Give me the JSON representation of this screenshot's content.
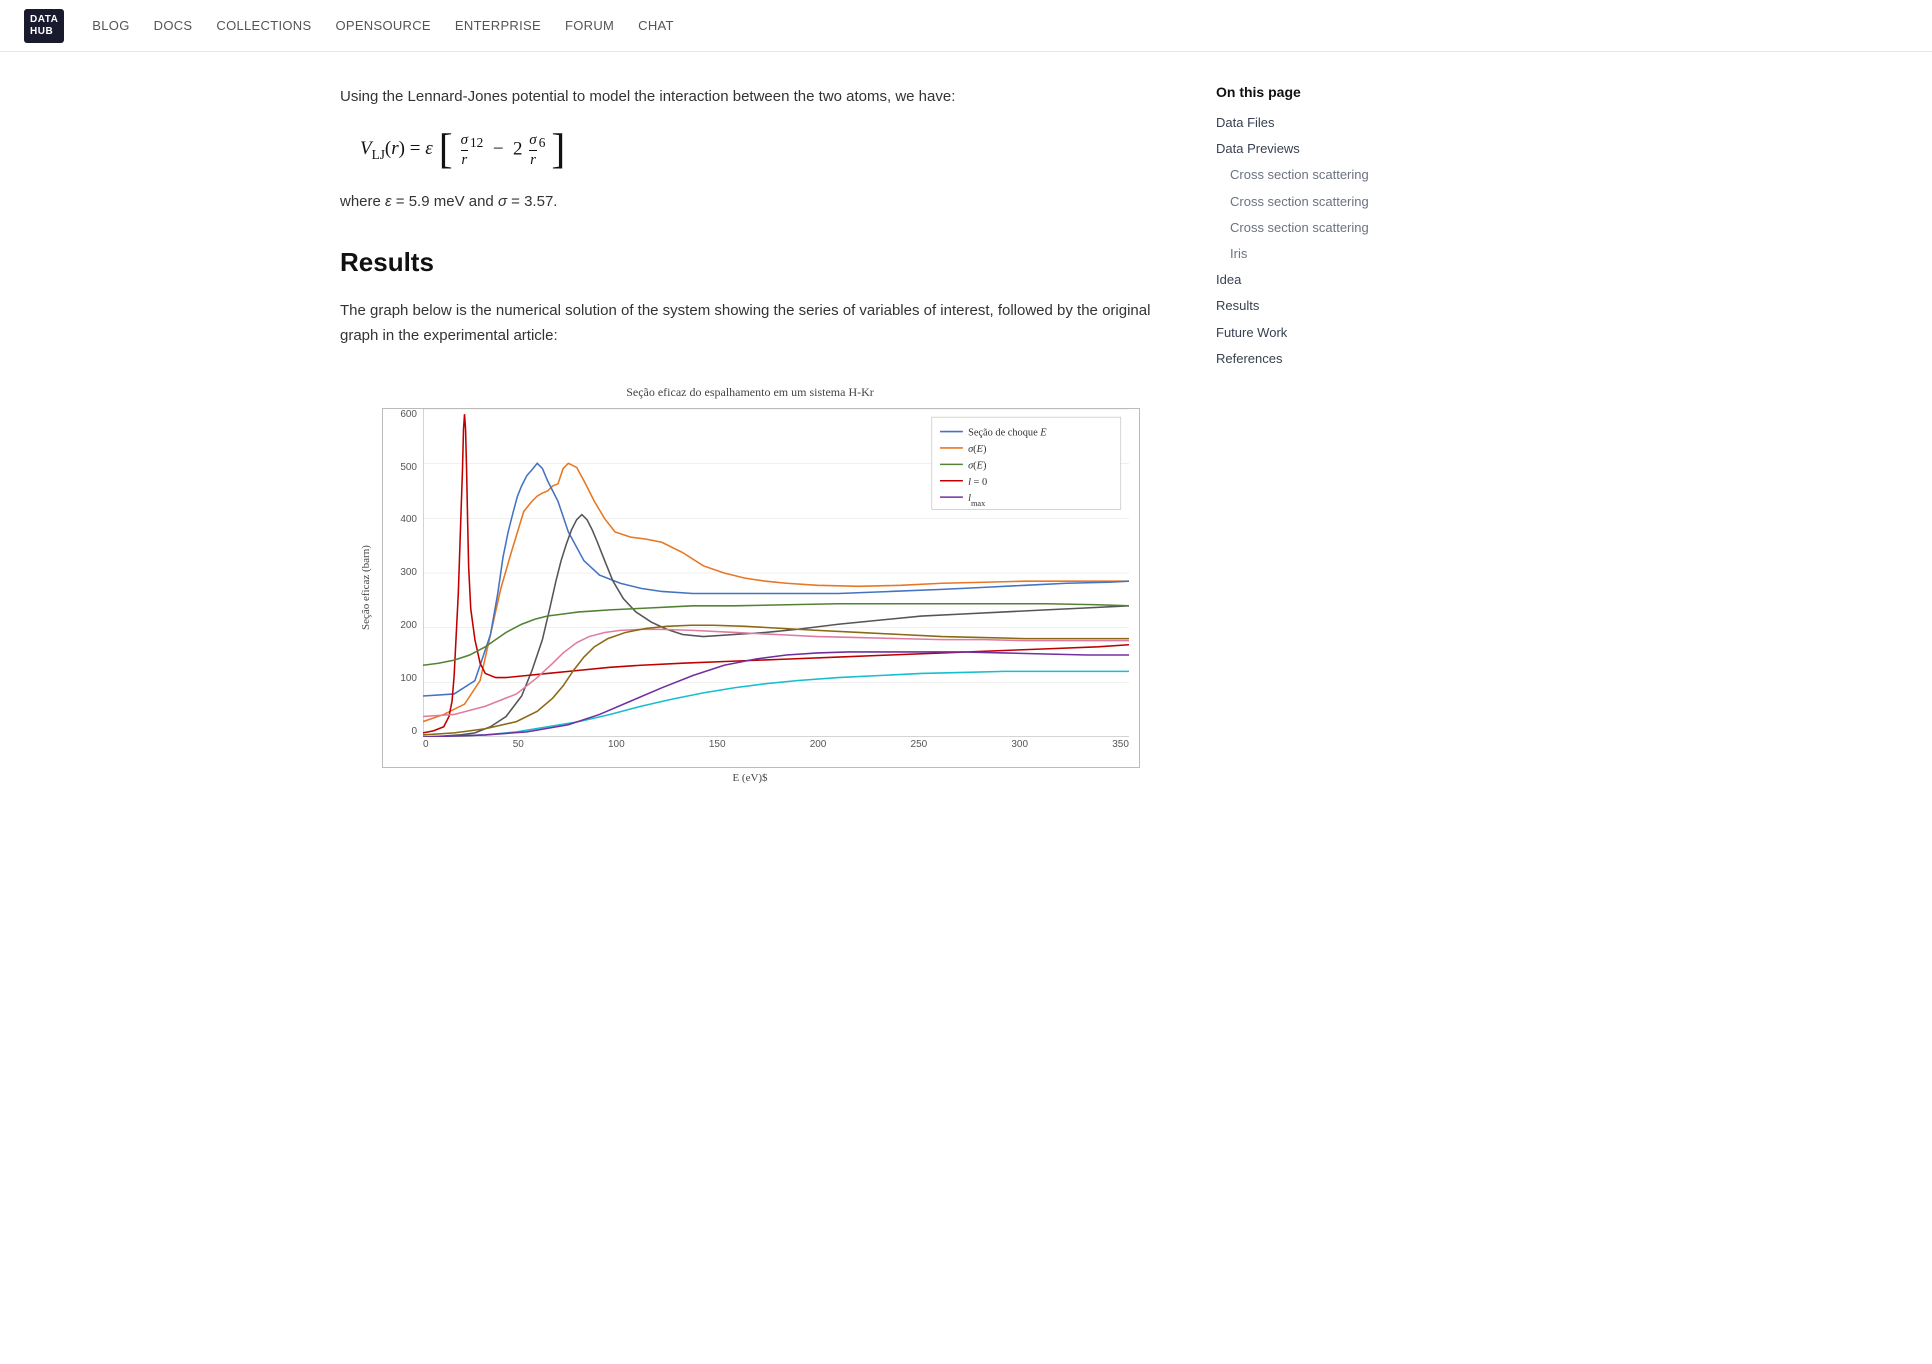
{
  "navbar": {
    "logo_line1": "DATA",
    "logo_line2": "HUB",
    "links": [
      "BLOG",
      "DOCS",
      "COLLECTIONS",
      "OPENSOURCE",
      "ENTERPRISE",
      "FORUM",
      "CHAT"
    ]
  },
  "sidebar": {
    "title": "On this page",
    "items": [
      {
        "label": "Data Files",
        "level": "top",
        "id": "data-files"
      },
      {
        "label": "Data Previews",
        "level": "top",
        "id": "data-previews"
      },
      {
        "label": "Cross section scattering",
        "level": "sub",
        "id": "cross1"
      },
      {
        "label": "Cross section scattering",
        "level": "sub",
        "id": "cross2"
      },
      {
        "label": "Cross section scattering",
        "level": "sub",
        "id": "cross3"
      },
      {
        "label": "Iris",
        "level": "sub",
        "id": "iris"
      },
      {
        "label": "Idea",
        "level": "top",
        "id": "idea"
      },
      {
        "label": "Results",
        "level": "top",
        "id": "results"
      },
      {
        "label": "Future Work",
        "level": "top",
        "id": "future-work"
      },
      {
        "label": "References",
        "level": "top",
        "id": "references"
      }
    ]
  },
  "content": {
    "intro": "Using the Lennard-Jones potential to model the interaction between the two atoms, we have:",
    "formula_desc": "V_LJ(r) = ε [(σ/r)^12 − 2(σ/r)^6]",
    "where_text": "where ε = 5.9 meV and σ = 3.57.",
    "results_heading": "Results",
    "results_text": "The graph below is the numerical solution of the system showing the series of variables of interest, followed by the original graph in the experimental article:",
    "chart": {
      "title": "Seção eficaz do espalhamento em um sistema H-Kr",
      "x_label": "E (eV)$",
      "y_label": "Seção eficaz (barn)",
      "x_ticks": [
        "0",
        "50",
        "100",
        "150",
        "200",
        "250",
        "300",
        "350"
      ],
      "y_ticks": [
        "0",
        "100",
        "200",
        "300",
        "400",
        "500",
        "600"
      ],
      "legend": [
        {
          "label": "Seção de choque E",
          "color": "#4472C4"
        },
        {
          "label": "σ(E)",
          "color": "#E87722"
        },
        {
          "label": "σ(E)",
          "color": "#548235"
        },
        {
          "label": "l = 0",
          "color": "#C00000"
        },
        {
          "label": "l_max",
          "color": "#7030A0"
        }
      ]
    }
  }
}
